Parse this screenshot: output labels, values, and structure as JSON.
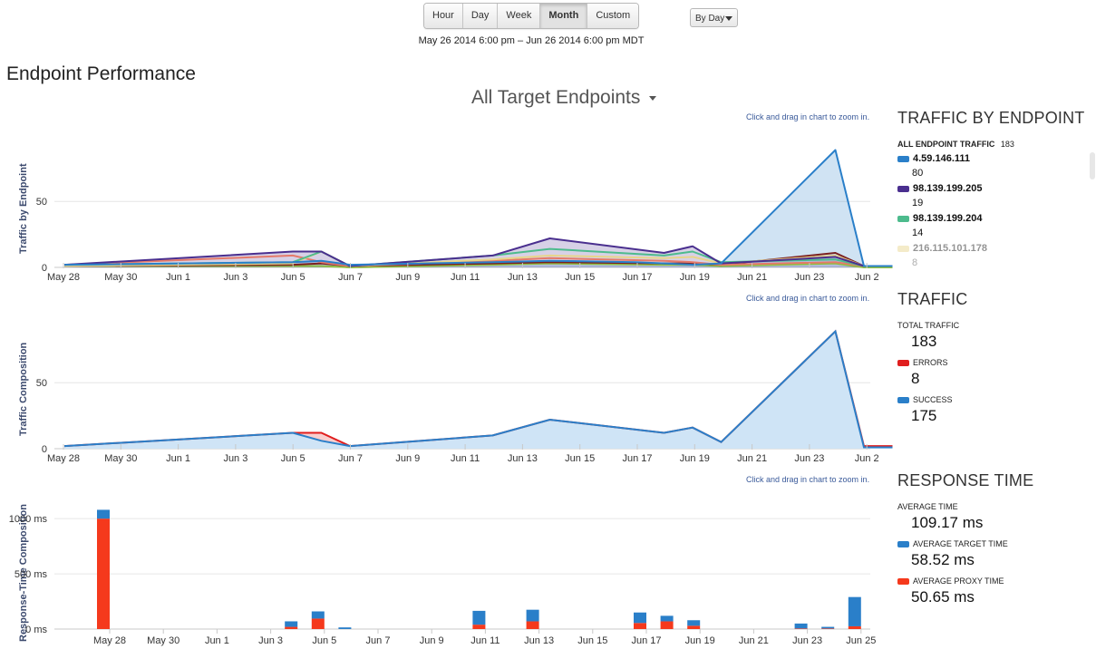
{
  "toolbar": {
    "ranges": [
      "Hour",
      "Day",
      "Week",
      "Month",
      "Custom"
    ],
    "active": "Month",
    "group_by": "By Day",
    "date_range": "May 26 2014 6:00 pm  –  Jun 26 2014 6:00 pm MDT"
  },
  "page_title": "Endpoint Performance",
  "target_selector": "All Target Endpoints",
  "zoom_hint": "Click and drag in chart to zoom in.",
  "chart_data": [
    {
      "type": "area",
      "ylabel": "Traffic by Endpoint",
      "ylim": [
        0,
        90
      ],
      "yticks": [
        0,
        50
      ],
      "xticks": [
        "May 28",
        "May 30",
        "Jun 1",
        "Jun 3",
        "Jun 5",
        "Jun 7",
        "Jun 9",
        "Jun 11",
        "Jun 13",
        "Jun 15",
        "Jun 17",
        "Jun 19",
        "Jun 21",
        "Jun 23",
        "Jun 2"
      ],
      "series": [
        {
          "name": "4.59.146.111",
          "color": "#2a7fc9",
          "fill": true,
          "points": [
            [
              "May 27",
              2
            ],
            [
              "Jun 4",
              4
            ],
            [
              "Jun 5",
              5
            ],
            [
              "Jun 6",
              2
            ],
            [
              "Jun 11",
              4
            ],
            [
              "Jun 13",
              5
            ],
            [
              "Jun 16",
              4
            ],
            [
              "Jun 17",
              3
            ],
            [
              "Jun 18",
              2
            ],
            [
              "Jun 19",
              3
            ],
            [
              "Jun 23",
              89
            ],
            [
              "Jun 24",
              1
            ],
            [
              "Jun 25",
              1
            ]
          ]
        },
        {
          "name": "98.139.199.205",
          "color": "#4a2f8f",
          "fill": true,
          "points": [
            [
              "May 27",
              2
            ],
            [
              "Jun 4",
              12
            ],
            [
              "Jun 5",
              12
            ],
            [
              "Jun 6",
              1
            ],
            [
              "Jun 11",
              9
            ],
            [
              "Jun 13",
              22
            ],
            [
              "Jun 17",
              11
            ],
            [
              "Jun 18",
              16
            ],
            [
              "Jun 19",
              3
            ],
            [
              "Jun 23",
              8
            ],
            [
              "Jun 24",
              1
            ],
            [
              "Jun 25",
              1
            ]
          ]
        },
        {
          "name": "98.139.199.204",
          "color": "#4dbb8d",
          "fill": false,
          "points": [
            [
              "May 27",
              2
            ],
            [
              "Jun 4",
              4
            ],
            [
              "Jun 5",
              12
            ],
            [
              "Jun 6",
              1
            ],
            [
              "Jun 11",
              9
            ],
            [
              "Jun 13",
              14
            ],
            [
              "Jun 17",
              9
            ],
            [
              "Jun 18",
              12
            ],
            [
              "Jun 19",
              4
            ],
            [
              "Jun 23",
              6
            ],
            [
              "Jun 24",
              1
            ],
            [
              "Jun 25",
              1
            ]
          ]
        },
        {
          "name": "216.115.101.178",
          "color": "#e8d58a",
          "fill": false,
          "points": [
            [
              "May 27",
              1
            ],
            [
              "Jun 4",
              3
            ],
            [
              "Jun 5",
              12
            ],
            [
              "Jun 6",
              1
            ],
            [
              "Jun 11",
              6
            ],
            [
              "Jun 13",
              9
            ],
            [
              "Jun 17",
              7
            ],
            [
              "Jun 18",
              8
            ],
            [
              "Jun 19",
              3
            ],
            [
              "Jun 23",
              9
            ],
            [
              "Jun 24",
              1
            ],
            [
              "Jun 25",
              1
            ]
          ]
        },
        {
          "name": "",
          "color": "#e57a6a",
          "fill": false,
          "points": [
            [
              "May 27",
              2
            ],
            [
              "Jun 4",
              9
            ],
            [
              "Jun 5",
              4
            ],
            [
              "Jun 6",
              1
            ],
            [
              "Jun 11",
              5
            ],
            [
              "Jun 13",
              7
            ],
            [
              "Jun 17",
              5
            ],
            [
              "Jun 18",
              4
            ],
            [
              "Jun 19",
              2
            ],
            [
              "Jun 23",
              4
            ],
            [
              "Jun 24",
              1
            ],
            [
              "Jun 25",
              1
            ]
          ]
        },
        {
          "name": "",
          "color": "#7b2020",
          "fill": false,
          "points": [
            [
              "May 27",
              1
            ],
            [
              "Jun 4",
              2
            ],
            [
              "Jun 5",
              3
            ],
            [
              "Jun 6",
              1
            ],
            [
              "Jun 11",
              3
            ],
            [
              "Jun 13",
              4
            ],
            [
              "Jun 17",
              3
            ],
            [
              "Jun 18",
              3
            ],
            [
              "Jun 19",
              2
            ],
            [
              "Jun 23",
              11
            ],
            [
              "Jun 24",
              1
            ],
            [
              "Jun 25",
              1
            ]
          ]
        },
        {
          "name": "",
          "color": "#8fbf3f",
          "fill": false,
          "points": [
            [
              "May 27",
              1
            ],
            [
              "Jun 4",
              1
            ],
            [
              "Jun 5",
              1
            ],
            [
              "Jun 6",
              0
            ],
            [
              "Jun 11",
              2
            ],
            [
              "Jun 13",
              3
            ],
            [
              "Jun 17",
              2
            ],
            [
              "Jun 18",
              2
            ],
            [
              "Jun 19",
              1
            ],
            [
              "Jun 23",
              3
            ],
            [
              "Jun 24",
              0
            ],
            [
              "Jun 25",
              0
            ]
          ]
        }
      ]
    },
    {
      "type": "area",
      "ylabel": "Traffic Composition",
      "ylim": [
        0,
        90
      ],
      "yticks": [
        0,
        50
      ],
      "xticks": [
        "May 28",
        "May 30",
        "Jun 1",
        "Jun 3",
        "Jun 5",
        "Jun 7",
        "Jun 9",
        "Jun 11",
        "Jun 13",
        "Jun 15",
        "Jun 17",
        "Jun 19",
        "Jun 21",
        "Jun 23",
        "Jun 2"
      ],
      "series": [
        {
          "name": "ERRORS",
          "color": "#e01e1e",
          "points": [
            [
              "May 27",
              2
            ],
            [
              "Jun 4",
              12
            ],
            [
              "Jun 5",
              12
            ],
            [
              "Jun 6",
              2
            ],
            [
              "Jun 11",
              10
            ],
            [
              "Jun 13",
              22
            ],
            [
              "Jun 17",
              12
            ],
            [
              "Jun 18",
              16
            ],
            [
              "Jun 19",
              5
            ],
            [
              "Jun 23",
              89
            ],
            [
              "Jun 24",
              2
            ],
            [
              "Jun 25",
              2
            ]
          ]
        },
        {
          "name": "SUCCESS",
          "color": "#2a7fc9",
          "points": [
            [
              "May 27",
              2
            ],
            [
              "Jun 4",
              12
            ],
            [
              "Jun 5",
              6
            ],
            [
              "Jun 6",
              2
            ],
            [
              "Jun 11",
              10
            ],
            [
              "Jun 13",
              22
            ],
            [
              "Jun 17",
              12
            ],
            [
              "Jun 18",
              16
            ],
            [
              "Jun 19",
              5
            ],
            [
              "Jun 23",
              89
            ],
            [
              "Jun 24",
              1
            ],
            [
              "Jun 25",
              1
            ]
          ]
        }
      ]
    },
    {
      "type": "bar",
      "ylabel": "Response-Time Composition",
      "ylim": [
        0,
        1100
      ],
      "yticks": [
        "0 ms",
        "500 ms",
        "1000 ms"
      ],
      "xticks": [
        "May 28",
        "May 30",
        "Jun 1",
        "Jun 3",
        "Jun 5",
        "Jun 7",
        "Jun 9",
        "Jun 11",
        "Jun 13",
        "Jun 15",
        "Jun 17",
        "Jun 19",
        "Jun 21",
        "Jun 23",
        "Jun 25"
      ],
      "series": [
        {
          "name": "AVERAGE PROXY TIME",
          "color": "#f5391c"
        },
        {
          "name": "AVERAGE TARGET TIME",
          "color": "#2a7fc9"
        }
      ],
      "bars": [
        {
          "date": "May 28",
          "proxy": 1000,
          "target": 80
        },
        {
          "date": "Jun 4",
          "proxy": 20,
          "target": 50
        },
        {
          "date": "Jun 5",
          "proxy": 95,
          "target": 65
        },
        {
          "date": "Jun 6",
          "proxy": 0,
          "target": 15
        },
        {
          "date": "Jun 11",
          "proxy": 40,
          "target": 125
        },
        {
          "date": "Jun 13",
          "proxy": 70,
          "target": 105
        },
        {
          "date": "Jun 17",
          "proxy": 55,
          "target": 95
        },
        {
          "date": "Jun 18",
          "proxy": 70,
          "target": 50
        },
        {
          "date": "Jun 19",
          "proxy": 30,
          "target": 50
        },
        {
          "date": "Jun 23",
          "proxy": 5,
          "target": 45
        },
        {
          "date": "Jun 24",
          "proxy": 5,
          "target": 15
        },
        {
          "date": "Jun 25",
          "proxy": 25,
          "target": 265
        }
      ]
    }
  ],
  "traffic_by_endpoint": {
    "title": "TRAFFIC BY ENDPOINT",
    "all_label": "ALL ENDPOINT TRAFFIC",
    "all_count": "183",
    "items": [
      {
        "ip": "4.59.146.111",
        "count": "80",
        "color": "#2a7fc9"
      },
      {
        "ip": "98.139.199.205",
        "count": "19",
        "color": "#4a2f8f"
      },
      {
        "ip": "98.139.199.204",
        "count": "14",
        "color": "#4dbb8d"
      },
      {
        "ip": "216.115.101.178",
        "count": "8",
        "color": "#e8d58a"
      }
    ]
  },
  "traffic": {
    "title": "TRAFFIC",
    "total_label": "TOTAL TRAFFIC",
    "total": "183",
    "errors_label": "ERRORS",
    "errors": "8",
    "errors_color": "#e01e1e",
    "success_label": "SUCCESS",
    "success": "175",
    "success_color": "#2a7fc9"
  },
  "response_time": {
    "title": "RESPONSE TIME",
    "avg_label": "AVERAGE TIME",
    "avg": "109.17 ms",
    "target_label": "AVERAGE TARGET TIME",
    "target": "58.52 ms",
    "target_color": "#2a7fc9",
    "proxy_label": "AVERAGE PROXY TIME",
    "proxy": "50.65 ms",
    "proxy_color": "#f5391c"
  }
}
